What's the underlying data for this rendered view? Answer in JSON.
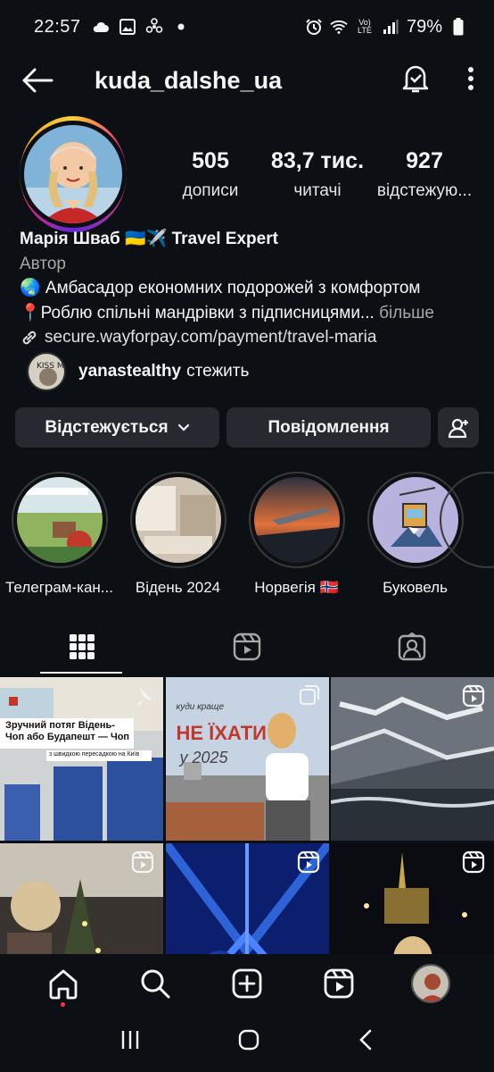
{
  "status": {
    "time": "22:57",
    "battery": "79%",
    "network": "Vo) LTE"
  },
  "header": {
    "username": "kuda_dalshe_ua"
  },
  "profile": {
    "posts_count": "505",
    "posts_label": "дописи",
    "followers_count": "83,7 тис.",
    "followers_label": "читачі",
    "following_count": "927",
    "following_label": "відстежую..."
  },
  "bio": {
    "name": "Марія Шваб 🇺🇦✈️ Travel Expert",
    "category": "Автор",
    "line1": "🌏 Амбасадор економних подорожей з комфортом",
    "line2": "📍Роблю спільні мандрівки з підписницями...",
    "more": "більше",
    "link": "secure.wayforpay.com/payment/travel-maria"
  },
  "followed_by": {
    "username": "yanastealthy",
    "suffix": "стежить"
  },
  "buttons": {
    "following": "Відстежується",
    "message": "Повідомлення"
  },
  "highlights": [
    {
      "label": "Телеграм-кан..."
    },
    {
      "label": "Відень 2024"
    },
    {
      "label": "Норвегія 🇳🇴"
    },
    {
      "label": "Буковель"
    }
  ],
  "posts": [
    {
      "caption": "Зручний потяг Відень-Чоп або Будапешт — Чоп",
      "sub": "з швидкою пересадкою на Київ"
    },
    {
      "caption": "НЕ ЇХАТИ",
      "script": "куди краще",
      "year": "у 2025"
    }
  ],
  "colors": {
    "background": "#0c1014",
    "button": "#262a30",
    "text": "#f5f5f5",
    "muted": "#a8a8a8"
  }
}
